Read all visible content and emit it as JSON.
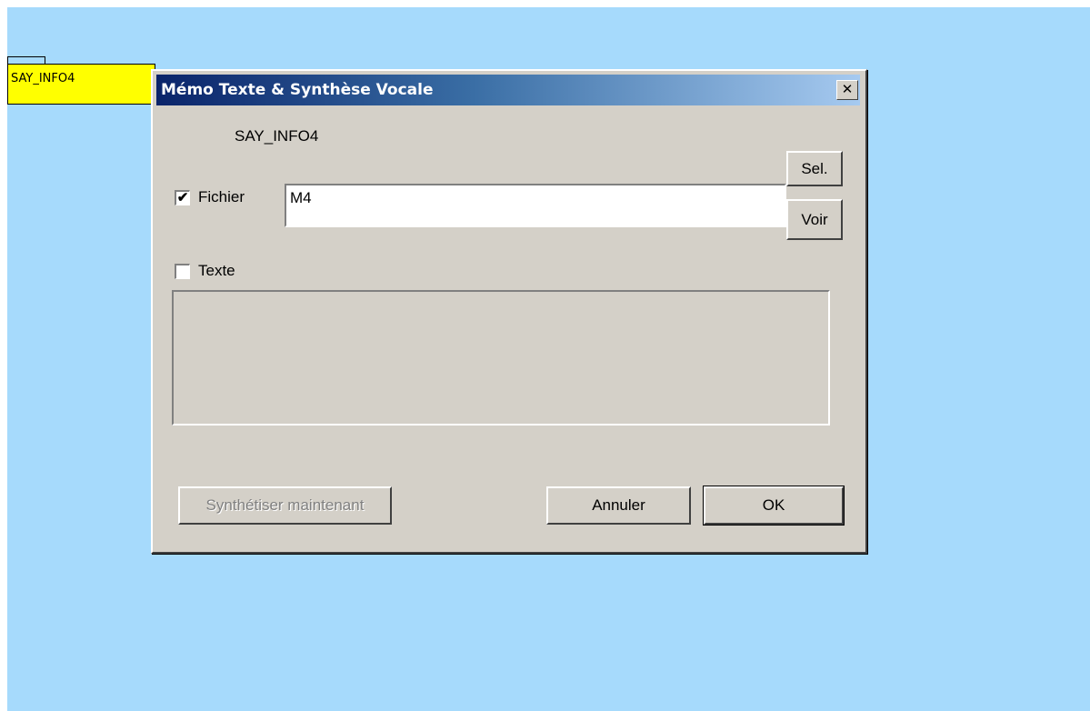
{
  "canvas": {
    "background": "#a6dafc",
    "node": {
      "label": "SAY_INFO4",
      "color": "#ffff00"
    }
  },
  "dialog": {
    "title": "Mémo Texte & Synthèse Vocale",
    "close_label": "✕",
    "name_label": "SAY_INFO4",
    "fichier": {
      "checked": true,
      "check_glyph": "✔",
      "label": "Fichier",
      "value": "M4"
    },
    "sel_label": "Sel.",
    "voir_label": "Voir",
    "texte": {
      "checked": false,
      "check_glyph": "",
      "label": "Texte",
      "value": ""
    },
    "buttons": {
      "synth_label": "Synthétiser maintenant",
      "synth_enabled": false,
      "cancel_label": "Annuler",
      "ok_label": "OK"
    },
    "colors": {
      "face": "#d4d0c8",
      "title_start": "#0a246a",
      "title_end": "#a6caf0"
    }
  }
}
